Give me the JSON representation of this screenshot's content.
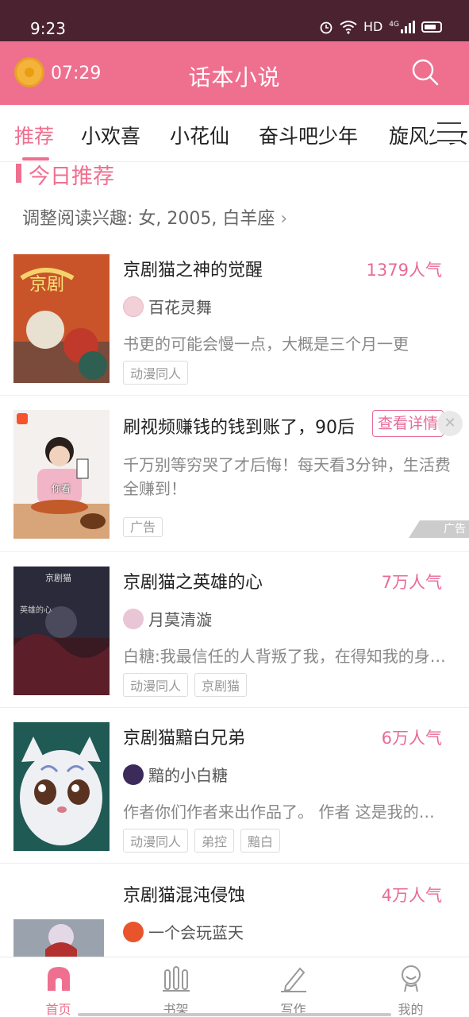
{
  "status": {
    "time": "9:23",
    "network": "HD",
    "signal": "4G"
  },
  "header": {
    "timer": "07:29",
    "title": "话本小说"
  },
  "tabs": [
    "推荐",
    "小欢喜",
    "小花仙",
    "奋斗吧少年",
    "旋风少女"
  ],
  "section": {
    "title": "今日推荐",
    "interest": "调整阅读兴趣: 女, 2005, 白羊座"
  },
  "books": [
    {
      "title": "京剧猫之神的觉醒",
      "popularity": "1379人气",
      "author": "百花灵舞",
      "desc": "书更的可能会慢一点，大概是三个月一更",
      "tags": [
        "动漫同人"
      ]
    },
    {
      "title": "京剧猫之英雄的心",
      "popularity": "7万人气",
      "author": "月莫清漩",
      "desc": "白糖:我最信任的人背叛了我，在得知我的身世后",
      "tags": [
        "动漫同人",
        "京剧猫"
      ]
    },
    {
      "title": "京剧猫黯白兄弟",
      "popularity": "6万人气",
      "author": "黯的小白糖",
      "desc": "作者你们作者来出作品了。 作者 这是我的作品",
      "tags": [
        "动漫同人",
        "弟控",
        "黯白"
      ]
    },
    {
      "title": "京剧猫混沌侵蚀",
      "popularity": "4万人气",
      "author": "一个会玩蓝天",
      "desc": "",
      "tags": []
    }
  ],
  "ad": {
    "title": "刷视频赚钱的钱到账了，90后",
    "detail_button": "查看详情",
    "desc": "千万别等穷哭了才后悔！每天看3分钟，生活费全赚到！",
    "tag": "广告",
    "corner": "广告",
    "cover_caption": "你看"
  },
  "nav": [
    {
      "label": "首页",
      "icon": "home-icon"
    },
    {
      "label": "书架",
      "icon": "bookshelf-icon"
    },
    {
      "label": "写作",
      "icon": "pen-icon"
    },
    {
      "label": "我的",
      "icon": "profile-icon"
    }
  ],
  "colors": {
    "accent": "#ef6f8f",
    "popularity": "#e86a98",
    "status_bar": "#4a2230"
  }
}
